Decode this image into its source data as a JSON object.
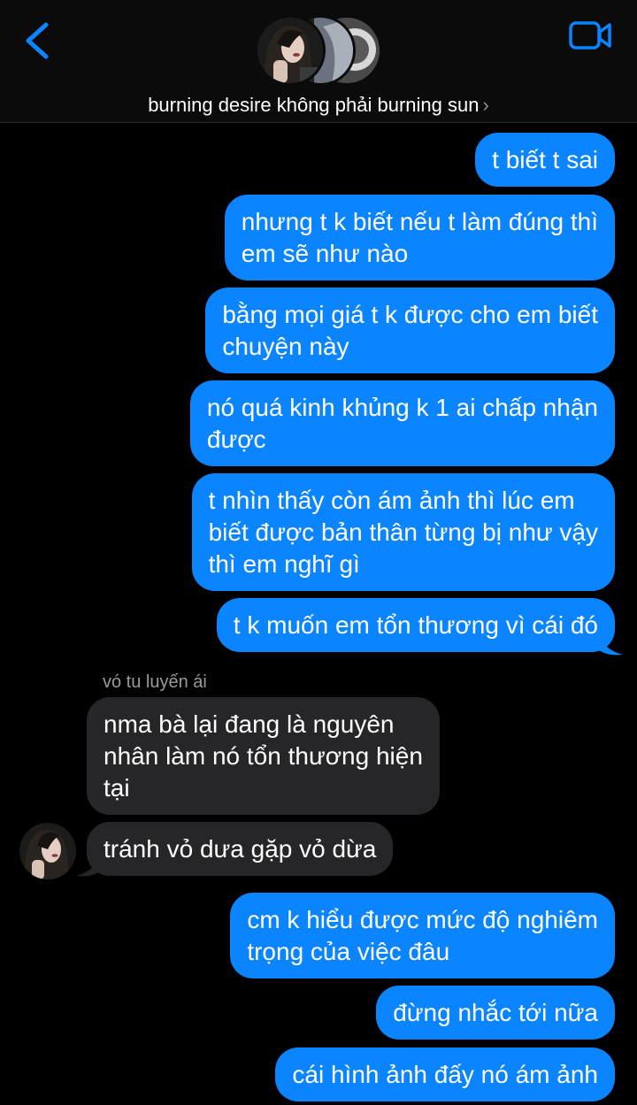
{
  "colors": {
    "accent": "#0a84ff",
    "incoming_bubble": "#262628",
    "background": "#000000"
  },
  "header": {
    "back_icon": "chevron-left-icon",
    "video_icon": "video-camera-icon",
    "title": "burning desire không phải burning sun",
    "title_chevron": "›"
  },
  "messages": [
    {
      "direction": "outgoing",
      "text": "t biết t sai"
    },
    {
      "direction": "outgoing",
      "text": "nhưng t k biết nếu t làm đúng thì\nem sẽ như nào"
    },
    {
      "direction": "outgoing",
      "text": "bằng mọi giá t k được cho em biết\nchuyện này"
    },
    {
      "direction": "outgoing",
      "text": "nó quá kinh khủng k 1 ai chấp nhận\nđược"
    },
    {
      "direction": "outgoing",
      "text": "t nhìn thấy còn ám ảnh thì lúc em\nbiết được bản thân từng bị như vậy\nthì em nghĩ gì"
    },
    {
      "direction": "outgoing",
      "text": "t k muốn em tổn thương vì cái đó"
    },
    {
      "direction": "incoming",
      "sender": "vó tu luyến ái",
      "text": "nma bà lại đang là nguyên\nnhân làm nó tổn thương hiện\ntại"
    },
    {
      "direction": "incoming",
      "text": "tránh vỏ dưa gặp vỏ dừa"
    },
    {
      "direction": "outgoing",
      "text": "cm k hiểu được mức độ nghiêm\ntrọng của việc đâu"
    },
    {
      "direction": "outgoing",
      "text": "đừng nhắc tới nữa"
    },
    {
      "direction": "outgoing",
      "text": "cái hình ảnh đấy nó ám ảnh"
    }
  ]
}
